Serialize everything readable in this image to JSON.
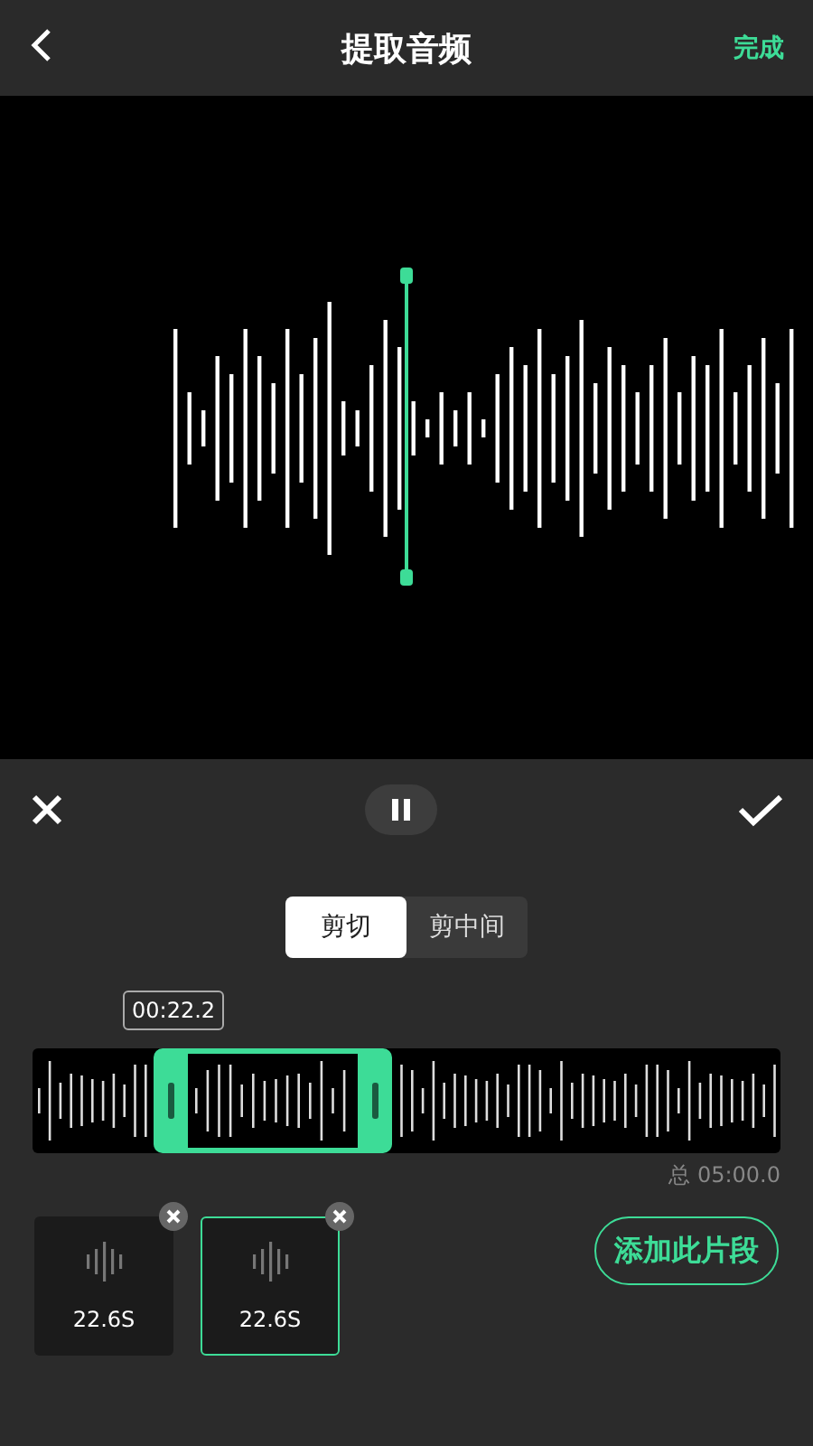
{
  "header": {
    "title": "提取音频",
    "done": "完成"
  },
  "modes": [
    {
      "label": "剪切",
      "selected": true
    },
    {
      "label": "剪中间",
      "selected": false
    }
  ],
  "timeline": {
    "current_time": "00:22.2",
    "total": "总 05:00.0"
  },
  "clips": [
    {
      "duration": "22.6S",
      "selected": false
    },
    {
      "duration": "22.6S",
      "selected": true
    }
  ],
  "add_button": "添加此片段"
}
